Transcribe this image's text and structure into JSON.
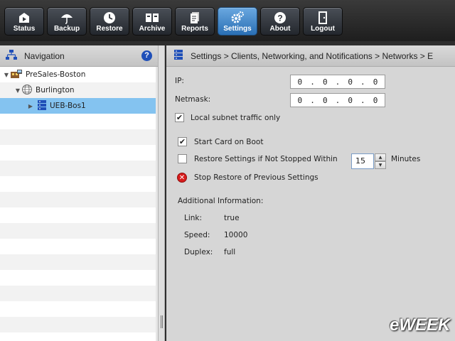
{
  "toolbar": {
    "buttons": [
      {
        "label": "Status",
        "icon": "status-icon"
      },
      {
        "label": "Backup",
        "icon": "umbrella-icon"
      },
      {
        "label": "Restore",
        "icon": "clock-icon"
      },
      {
        "label": "Archive",
        "icon": "archive-icon"
      },
      {
        "label": "Reports",
        "icon": "document-icon"
      },
      {
        "label": "Settings",
        "icon": "gear-icon",
        "active": true
      },
      {
        "label": "About",
        "icon": "question-icon"
      },
      {
        "label": "Logout",
        "icon": "door-icon"
      }
    ]
  },
  "navigation": {
    "title": "Navigation",
    "tree": [
      {
        "label": "PreSales-Boston",
        "icon": "site-icon",
        "expanded": true
      },
      {
        "label": "Burlington",
        "icon": "globe-icon",
        "expanded": true
      },
      {
        "label": "UEB-Bos1",
        "icon": "server-icon",
        "selected": true
      }
    ]
  },
  "main": {
    "breadcrumb": "Settings > Clients, Networking, and Notifications > Networks > E",
    "ip_label": "IP:",
    "ip_octets": [
      "0",
      "0",
      "0",
      "0"
    ],
    "netmask_label": "Netmask:",
    "netmask_octets": [
      "0",
      "0",
      "0",
      "0"
    ],
    "ip_dot": ".",
    "local_subnet": {
      "label": "Local subnet traffic only",
      "checked": true
    },
    "start_card": {
      "label": "Start Card on Boot",
      "checked": true
    },
    "restore_settings": {
      "label": "Restore Settings if Not Stopped Within",
      "checked": false,
      "value": "15",
      "unit": "Minutes"
    },
    "stop_restore": {
      "label": "Stop Restore of Previous Settings"
    },
    "additional_title": "Additional Information:",
    "info": [
      {
        "key": "Link:",
        "value": "true"
      },
      {
        "key": "Speed:",
        "value": "10000"
      },
      {
        "key": "Duplex:",
        "value": "full"
      }
    ]
  },
  "watermark": "eWEEK",
  "colors": {
    "toolbar_bg": "#2a2a2a",
    "active_button": "#3f86cc",
    "selection": "#84c3f0",
    "panel_bg": "#d6d6d6"
  }
}
